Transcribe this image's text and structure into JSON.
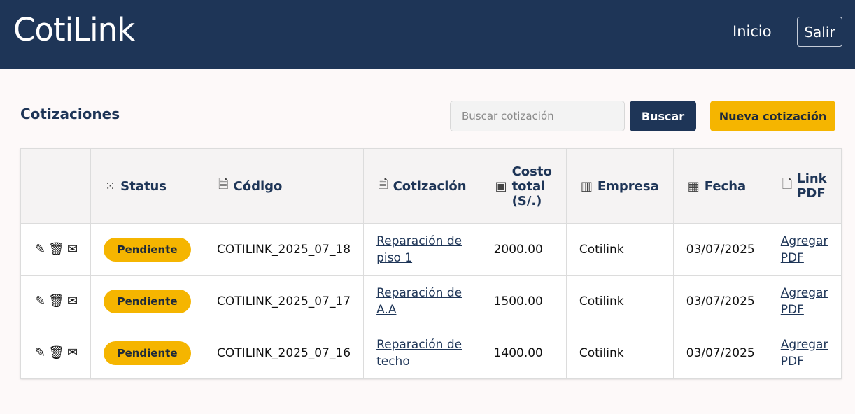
{
  "header": {
    "brand": "CotiLink",
    "home_label": "Inicio",
    "logout_label": "Salir"
  },
  "toolbar": {
    "title": "Cotizaciones",
    "search_placeholder": "Buscar cotización",
    "search_button": "Buscar",
    "new_button": "Nueva cotización"
  },
  "table": {
    "columns": [
      {
        "label": "",
        "icon": "none"
      },
      {
        "label": "Status",
        "icon": "spinner-icon"
      },
      {
        "label": "Código",
        "icon": "document-icon"
      },
      {
        "label": "Cotización",
        "icon": "document-icon"
      },
      {
        "label": "Costo total (S/.)",
        "icon": "money-icon"
      },
      {
        "label": "Empresa",
        "icon": "building-icon"
      },
      {
        "label": "Fecha",
        "icon": "calendar-icon"
      },
      {
        "label": "Link PDF",
        "icon": "pdf-icon"
      }
    ],
    "rows": [
      {
        "status": "Pendiente",
        "code": "COTILINK_2025_07_18",
        "quote": "Reparación de piso 1",
        "cost": "2000.00",
        "company": "Cotilink",
        "date": "03/07/2025",
        "pdf": "Agregar PDF"
      },
      {
        "status": "Pendiente",
        "code": "COTILINK_2025_07_17",
        "quote": "Reparación de A.A",
        "cost": "1500.00",
        "company": "Cotilink",
        "date": "03/07/2025",
        "pdf": "Agregar PDF"
      },
      {
        "status": "Pendiente",
        "code": "COTILINK_2025_07_16",
        "quote": "Reparación de techo",
        "cost": "1400.00",
        "company": "Cotilink",
        "date": "03/07/2025",
        "pdf": "Agregar PDF"
      }
    ]
  },
  "colors": {
    "primary": "#1e3557",
    "accent": "#f5b500",
    "background": "#fdf9f9"
  }
}
